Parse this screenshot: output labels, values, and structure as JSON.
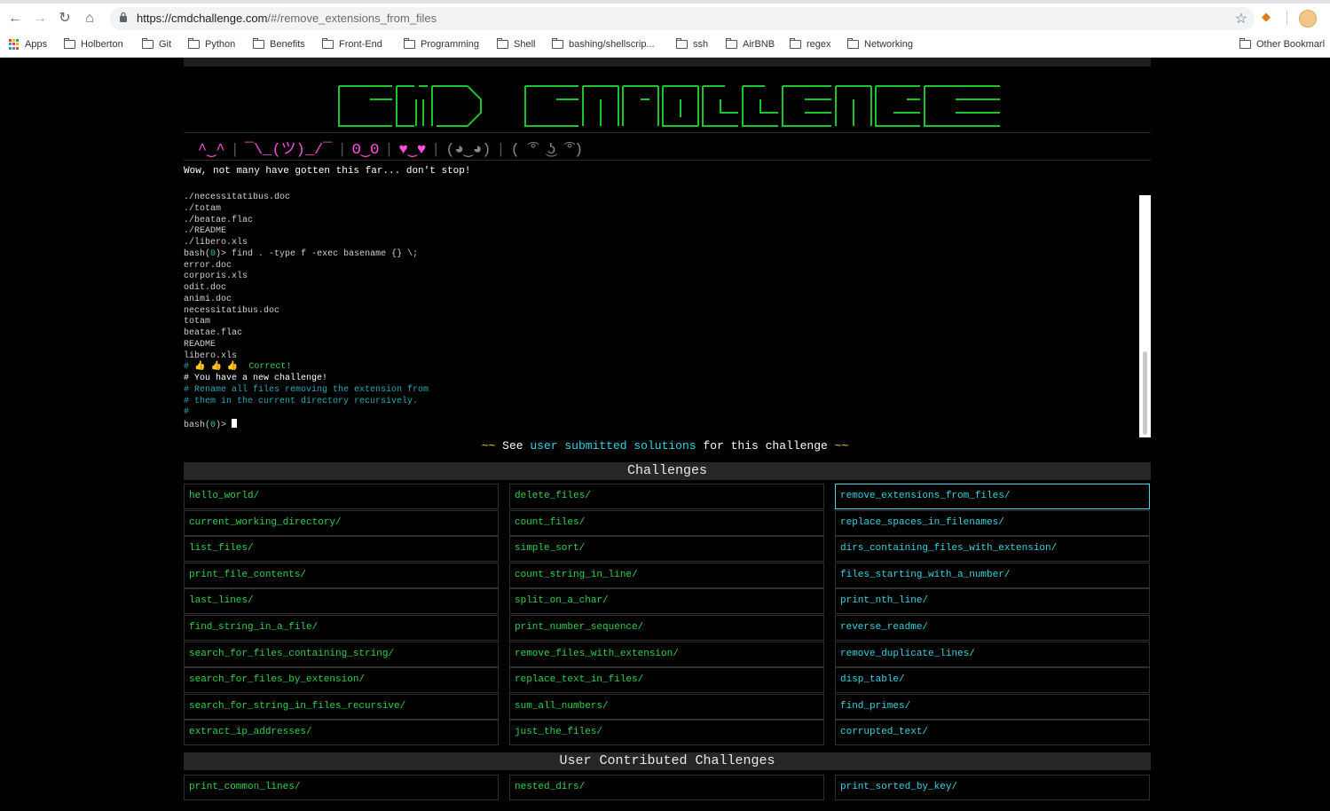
{
  "browser": {
    "url_host": "https://cmdchallenge.com",
    "url_path": "/#/remove_extensions_from_files",
    "bookmarks": [
      "Apps",
      "Holberton",
      "Git",
      "Python",
      "Benefits",
      "Front-End",
      "Programming",
      "Shell",
      "bashing/shellscrip...",
      "ssh",
      "AirBNB",
      "regex",
      "Networking"
    ],
    "other_bookmarks": "Other Bookmarl"
  },
  "emoji_bar": {
    "faces": [
      "^‿^",
      "¯\\_(ツ)_/¯",
      "ʘ‿ʘ",
      "♥‿♥",
      "(◕‿◕)",
      "( ͡° ͜ʖ ͡°)"
    ]
  },
  "intro_text": "Wow, not many have gotten this far... don't stop!",
  "terminal": {
    "lines": [
      {
        "text": "./necessitatibus.doc",
        "style": "default"
      },
      {
        "text": "./totam",
        "style": "default"
      },
      {
        "text": "./beatae.flac",
        "style": "default"
      },
      {
        "text": "./README",
        "style": "default"
      },
      {
        "text": "./libero.xls",
        "style": "default"
      },
      {
        "prompt": true,
        "text": " find . -type f -exec basename {} \\;"
      },
      {
        "text": "error.doc",
        "style": "default"
      },
      {
        "text": "corporis.xls",
        "style": "default"
      },
      {
        "text": "odit.doc",
        "style": "default"
      },
      {
        "text": "animi.doc",
        "style": "default"
      },
      {
        "text": "necessitatibus.doc",
        "style": "default"
      },
      {
        "text": "totam",
        "style": "default"
      },
      {
        "text": "beatae.flac",
        "style": "default"
      },
      {
        "text": "README",
        "style": "default"
      },
      {
        "text": "libero.xls",
        "style": "default"
      },
      {
        "correct": true,
        "text": "# 👍 👍 👍  Correct!"
      },
      {
        "text": "# You have a new challenge!",
        "style": "white"
      },
      {
        "text": "# Rename all files removing the extension from",
        "style": "cyan"
      },
      {
        "text": "# them in the current directory recursively.",
        "style": "cyan"
      },
      {
        "text": "#",
        "style": "cyan"
      },
      {
        "prompt": true,
        "text": " ",
        "cursor": true
      }
    ],
    "prompt_prefix": "bash(",
    "prompt_status": "0",
    "prompt_suffix": ")>",
    "correct_label": "Correct!"
  },
  "submitted": {
    "squiggle": "~~",
    "see": "See",
    "link": "user submitted solutions",
    "rest": "for this challenge"
  },
  "challenges": {
    "title": "Challenges",
    "active": "remove_extensions_from_files/",
    "col1": [
      "hello_world/",
      "current_working_directory/",
      "list_files/",
      "print_file_contents/",
      "last_lines/",
      "find_string_in_a_file/",
      "search_for_files_containing_string/",
      "search_for_files_by_extension/",
      "search_for_string_in_files_recursive/",
      "extract_ip_addresses/"
    ],
    "col2": [
      "delete_files/",
      "count_files/",
      "simple_sort/",
      "count_string_in_line/",
      "split_on_a_char/",
      "print_number_sequence/",
      "remove_files_with_extension/",
      "replace_text_in_files/",
      "sum_all_numbers/",
      "just_the_files/"
    ],
    "col3": [
      "remove_extensions_from_files/",
      "replace_spaces_in_filenames/",
      "dirs_containing_files_with_extension/",
      "files_starting_with_a_number/",
      "print_nth_line/",
      "reverse_readme/",
      "remove_duplicate_lines/",
      "disp_table/",
      "find_primes/",
      "corrupted_text/"
    ]
  },
  "user_challenges": {
    "title": "User Contributed Challenges",
    "col1": [
      "print_common_lines/"
    ],
    "col2": [
      "nested_dirs/"
    ],
    "col3": [
      "print_sorted_by_key/"
    ]
  },
  "colors": {
    "accent_green": "#2cd34a",
    "accent_cyan": "#37d4e3",
    "pink": "#ff4fd8",
    "squiggle_yellow": "#ffd500"
  }
}
